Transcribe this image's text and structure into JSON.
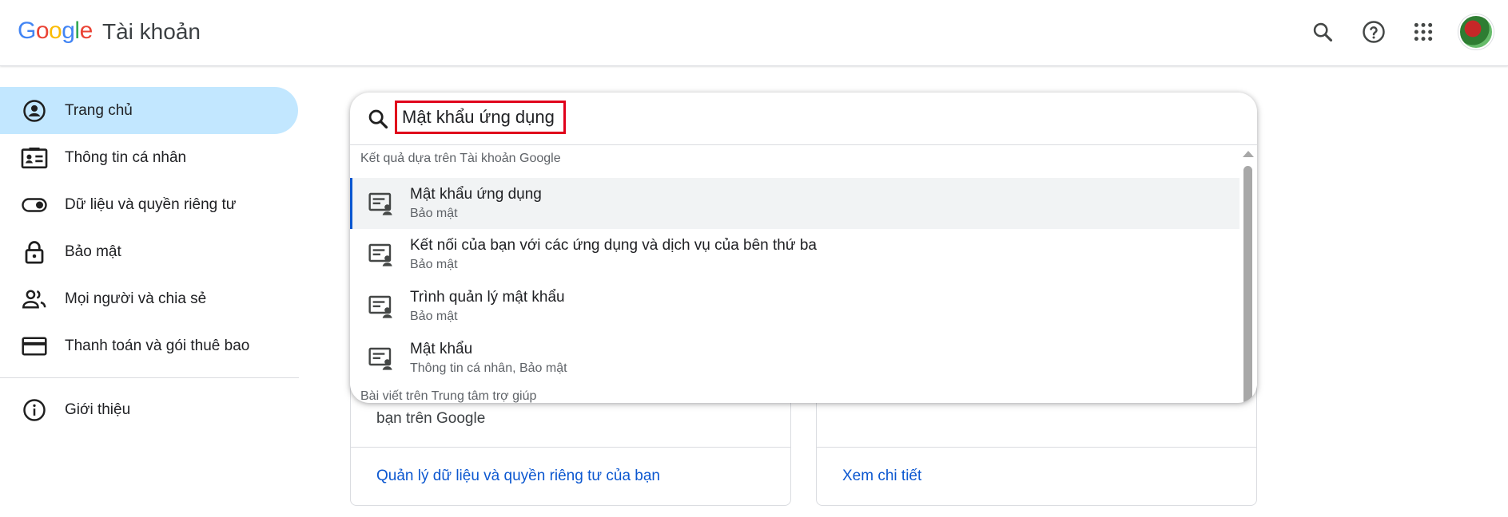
{
  "header": {
    "logo_letters": [
      "G",
      "o",
      "o",
      "g",
      "l",
      "e"
    ],
    "product_name": "Tài khoản"
  },
  "icons": {
    "search": "search-icon",
    "help": "help-icon",
    "apps": "apps-grid-icon",
    "avatar": "avatar"
  },
  "sidebar": {
    "items": [
      {
        "label": "Trang chủ",
        "icon": "home-account-icon",
        "active": true
      },
      {
        "label": "Thông tin cá nhân",
        "icon": "id-card-icon"
      },
      {
        "label": "Dữ liệu và quyền riêng tư",
        "icon": "toggle-icon"
      },
      {
        "label": "Bảo mật",
        "icon": "lock-icon"
      },
      {
        "label": "Mọi người và chia sẻ",
        "icon": "people-icon"
      },
      {
        "label": "Thanh toán và gói thuê bao",
        "icon": "credit-card-icon"
      }
    ],
    "about": {
      "label": "Giới thiệu",
      "icon": "info-icon"
    }
  },
  "search": {
    "value": "Mật khẩu ứng dụng",
    "results_header": "Kết quả dựa trên Tài khoản Google",
    "results": [
      {
        "title": "Mật khẩu ứng dụng",
        "subtitle": "Bảo mật",
        "selected": true
      },
      {
        "title": "Kết nối của bạn với các ứng dụng và dịch vụ của bên thứ ba",
        "subtitle": "Bảo mật"
      },
      {
        "title": "Trình quản lý mật khẩu",
        "subtitle": "Bảo mật"
      },
      {
        "title": "Mật khẩu",
        "subtitle": "Thông tin cá nhân, Bảo mật"
      }
    ],
    "help_header": "Bài viết trên Trung tâm trợ giúp"
  },
  "cards": {
    "left_text": "bạn trên Google",
    "left_link": "Quản lý dữ liệu và quyền riêng tư của bạn",
    "right_link": "Xem chi tiết"
  },
  "colors": {
    "active_nav": "#c2e7ff",
    "link": "#0b57d0",
    "highlight_box": "#e0001b"
  }
}
